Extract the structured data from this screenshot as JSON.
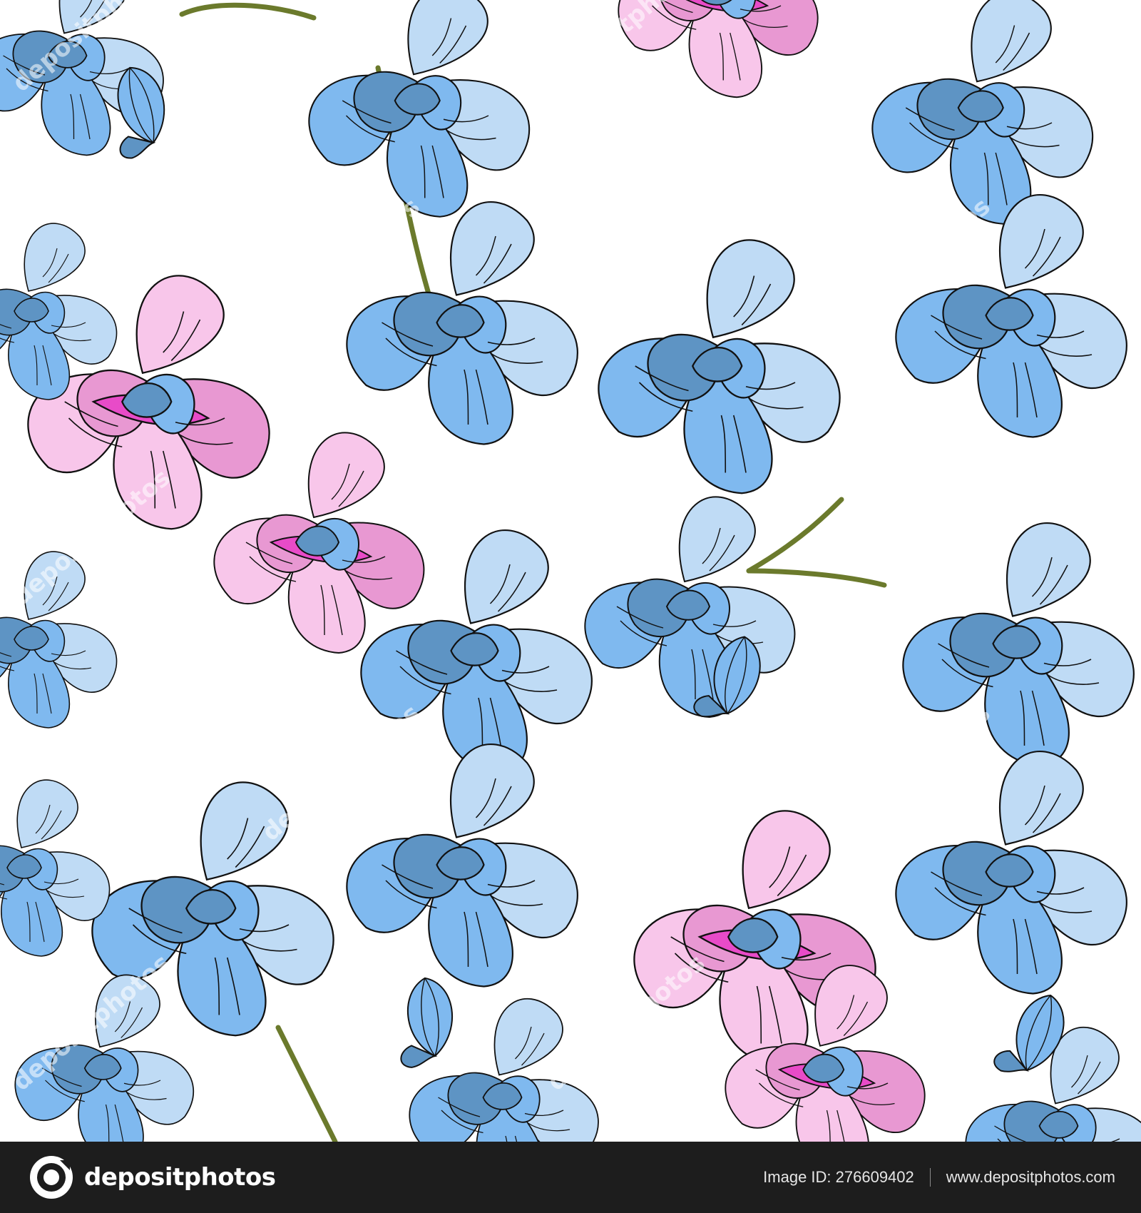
{
  "artwork": {
    "description": "Seamless pattern of blue and pink orchids",
    "colors": {
      "background": "#ffffff",
      "blue_light": "#bfdbf5",
      "blue_mid": "#7fb9ef",
      "blue_dark": "#5e94c4",
      "pink_light": "#f8c6ea",
      "pink_mid": "#e898d2",
      "magenta": "#e84bc8",
      "stem": "#6b7a2c",
      "outline": "#111111"
    },
    "watermark_text": "depositphotos"
  },
  "footer": {
    "brand_name": "depositphotos",
    "image_id": "Image ID: 276609402",
    "site": "www.depositphotos.com",
    "background": "#1d1d1d"
  }
}
